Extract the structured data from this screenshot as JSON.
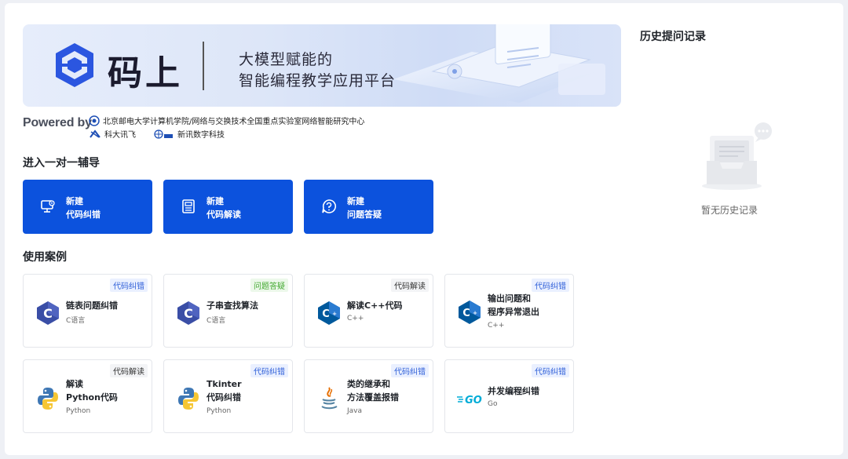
{
  "banner": {
    "brand_name": "码上",
    "subtitle_line1": "大模型赋能的",
    "subtitle_line2": "智能编程教学应用平台"
  },
  "powered": {
    "label": "Powered by",
    "partners": [
      "北京邮电大学计算机学院/网络与交换技术全国重点实验室网络智能研究中心",
      "科大讯飞",
      "新讯数字科技"
    ]
  },
  "sections": {
    "tutoring_title": "进入一对一辅导",
    "cases_title": "使用案例"
  },
  "actions": [
    {
      "line1": "新建",
      "line2": "代码纠错",
      "icon": "monitor-bug-icon"
    },
    {
      "line1": "新建",
      "line2": "代码解读",
      "icon": "document-icon"
    },
    {
      "line1": "新建",
      "line2": "问题答疑",
      "icon": "question-bubble-icon"
    }
  ],
  "cases": [
    {
      "tag": "代码纠错",
      "title": "链表问题纠错",
      "lang": "C语言",
      "icon": "c-language-icon"
    },
    {
      "tag": "问题答疑",
      "title": "子串查找算法",
      "lang": "C语言",
      "icon": "c-language-icon"
    },
    {
      "tag": "代码解读",
      "title": "解读C++代码",
      "lang": "C++",
      "icon": "cpp-language-icon"
    },
    {
      "tag": "代码纠错",
      "title1": "输出问题和",
      "title2": "程序异常退出",
      "lang": "C++",
      "icon": "cpp-language-icon"
    },
    {
      "tag": "代码解读",
      "title1": "解读",
      "title2": "Python代码",
      "lang": "Python",
      "icon": "python-icon"
    },
    {
      "tag": "代码纠错",
      "title1": "Tkinter",
      "title2": "代码纠错",
      "lang": "Python",
      "icon": "python-icon"
    },
    {
      "tag": "代码纠错",
      "title1": "类的继承和",
      "title2": "方法覆盖报错",
      "lang": "Java",
      "icon": "java-icon"
    },
    {
      "tag": "代码纠错",
      "title": "并发编程纠错",
      "lang": "Go",
      "icon": "go-icon"
    }
  ],
  "history": {
    "title": "历史提问记录",
    "empty_text": "暂无历史记录"
  },
  "colors": {
    "primary": "#0c52dd",
    "tag_blue": "#2f5fd8",
    "tag_green": "#42a930"
  }
}
